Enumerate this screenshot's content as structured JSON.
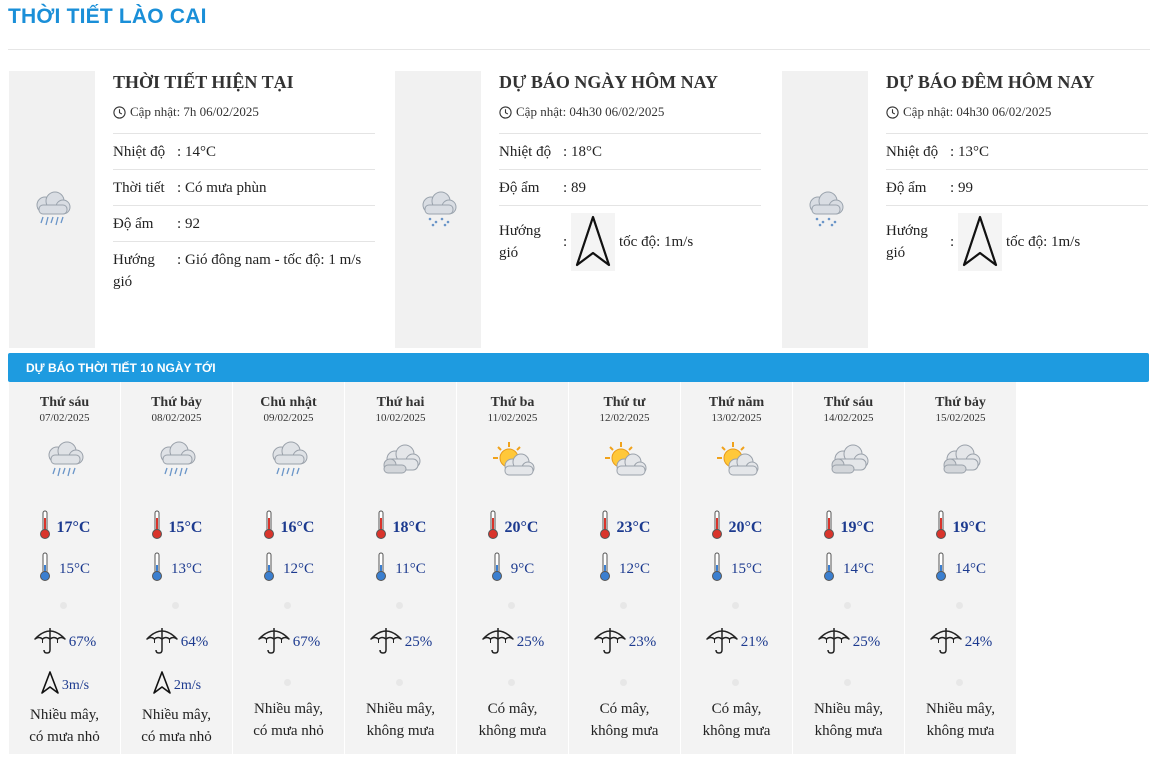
{
  "page_title": "THỜI TIẾT LÀO CAI",
  "panels": [
    {
      "title": "THỜI TIẾT HIỆN TẠI",
      "updated": "Cập nhật: 7h 06/02/2025",
      "icon": "rain-cloud-icon",
      "rows": [
        {
          "label": "Nhiệt độ",
          "value": "14°C"
        },
        {
          "label": "Thời tiết",
          "value": "Có mưa phùn"
        },
        {
          "label": "Độ ẩm",
          "value": "92"
        },
        {
          "label": "Hướng gió",
          "value": "Gió đông nam - tốc độ: 1 m/s"
        }
      ]
    },
    {
      "title": "DỰ BÁO NGÀY HÔM NAY",
      "updated": "Cập nhật: 04h30 06/02/2025",
      "icon": "rain-cloud-icon",
      "rows": [
        {
          "label": "Nhiệt độ",
          "value": "18°C"
        },
        {
          "label": "Độ ẩm",
          "value": "89"
        }
      ],
      "wind": {
        "label": "Hướng gió",
        "speed": "tốc độ: 1m/s"
      }
    },
    {
      "title": "DỰ BÁO ĐÊM HÔM NAY",
      "updated": "Cập nhật: 04h30 06/02/2025",
      "icon": "rain-cloud-icon",
      "rows": [
        {
          "label": "Nhiệt độ",
          "value": "13°C"
        },
        {
          "label": "Độ ẩm",
          "value": "99"
        }
      ],
      "wind": {
        "label": "Hướng gió",
        "speed": "tốc độ: 1m/s"
      }
    }
  ],
  "forecast_header": "DỰ BÁO THỜI TIẾT 10 NGÀY TỚI",
  "days": [
    {
      "name": "Thứ sáu",
      "date": "07/02/2025",
      "icon": "rain",
      "max": "17°C",
      "min": "15°C",
      "rain": "67%",
      "wind": "3m/s",
      "desc": [
        "Nhiều mây,",
        "có mưa nhỏ"
      ]
    },
    {
      "name": "Thứ bảy",
      "date": "08/02/2025",
      "icon": "rain",
      "max": "15°C",
      "min": "13°C",
      "rain": "64%",
      "wind": "2m/s",
      "desc": [
        "Nhiều mây,",
        "có mưa nhỏ"
      ]
    },
    {
      "name": "Chủ nhật",
      "date": "09/02/2025",
      "icon": "rain",
      "max": "16°C",
      "min": "12°C",
      "rain": "67%",
      "wind": "",
      "desc": [
        "Nhiều mây,",
        "có mưa nhỏ"
      ]
    },
    {
      "name": "Thứ hai",
      "date": "10/02/2025",
      "icon": "cloud",
      "max": "18°C",
      "min": "11°C",
      "rain": "25%",
      "wind": "",
      "desc": [
        "Nhiều mây,",
        "không mưa"
      ]
    },
    {
      "name": "Thứ ba",
      "date": "11/02/2025",
      "icon": "sun-cloud",
      "max": "20°C",
      "min": "9°C",
      "rain": "25%",
      "wind": "",
      "desc": [
        "Có mây,",
        "không mưa"
      ]
    },
    {
      "name": "Thứ tư",
      "date": "12/02/2025",
      "icon": "sun-cloud",
      "max": "23°C",
      "min": "12°C",
      "rain": "23%",
      "wind": "",
      "desc": [
        "Có mây,",
        "không mưa"
      ]
    },
    {
      "name": "Thứ năm",
      "date": "13/02/2025",
      "icon": "sun-cloud",
      "max": "20°C",
      "min": "15°C",
      "rain": "21%",
      "wind": "",
      "desc": [
        "Có mây,",
        "không mưa"
      ]
    },
    {
      "name": "Thứ sáu",
      "date": "14/02/2025",
      "icon": "cloud",
      "max": "19°C",
      "min": "14°C",
      "rain": "25%",
      "wind": "",
      "desc": [
        "Nhiều mây,",
        "không mưa"
      ]
    },
    {
      "name": "Thứ bảy",
      "date": "15/02/2025",
      "icon": "cloud",
      "max": "19°C",
      "min": "14°C",
      "rain": "24%",
      "wind": "",
      "desc": [
        "Nhiều mây,",
        "không mưa"
      ]
    }
  ]
}
